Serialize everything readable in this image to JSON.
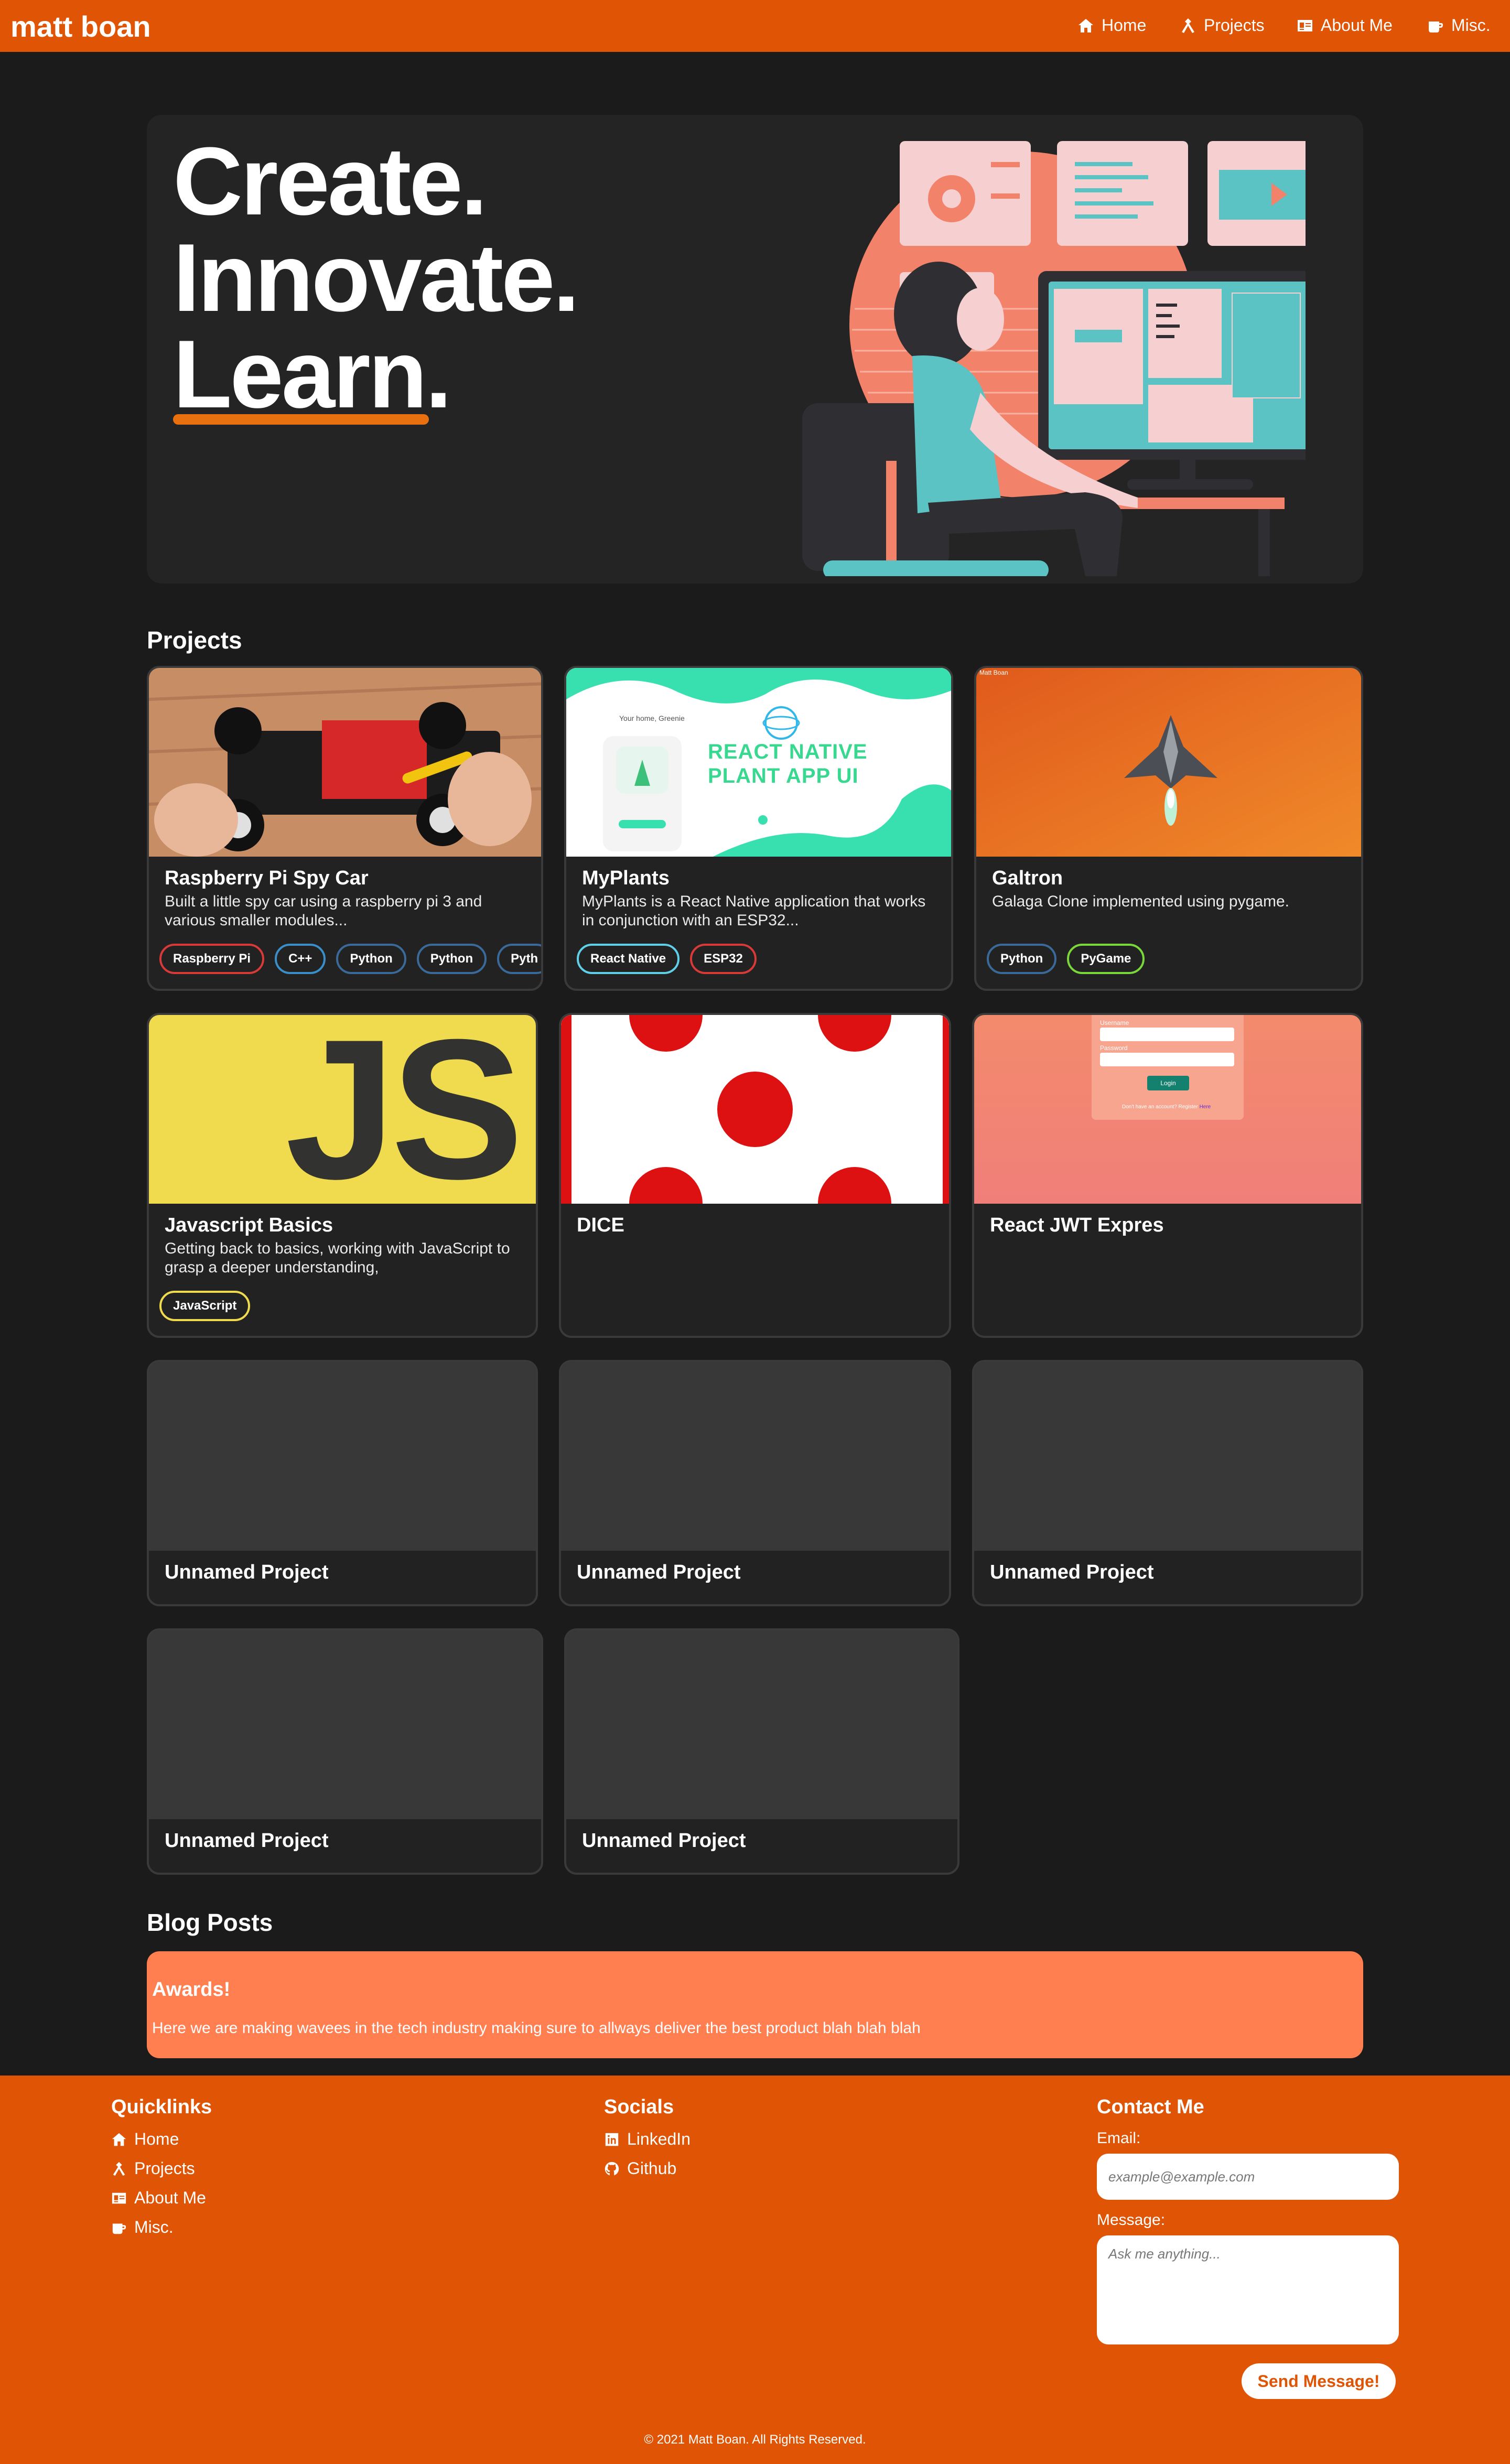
{
  "nav": {
    "brand": "matt boan",
    "items": [
      {
        "label": "Home",
        "icon": "home-icon"
      },
      {
        "label": "Projects",
        "icon": "tools-icon"
      },
      {
        "label": "About Me",
        "icon": "id-card-icon"
      },
      {
        "label": "Misc.",
        "icon": "mug-icon"
      }
    ]
  },
  "hero": {
    "lines": [
      "Create.",
      "Innovate.",
      "Learn."
    ],
    "accent_color": "#e9700f"
  },
  "projects": {
    "title": "Projects",
    "cards": [
      {
        "title": "Raspberry Pi Spy Car",
        "desc": "Built a little spy car using a raspberry pi 3 and various smaller modules...",
        "tags": [
          "Raspberry Pi",
          "C++",
          "Python",
          "Python",
          "Pyth"
        ]
      },
      {
        "title": "MyPlants",
        "desc": "MyPlants is a React Native application that works in conjunction with an ESP32...",
        "tags": [
          "React Native",
          "ESP32"
        ],
        "thumb": {
          "title_line1": "REACT NATIVE",
          "title_line2": "PLANT APP UI",
          "greeting": "Your home, Greenie"
        }
      },
      {
        "title": "Galtron",
        "desc": "Galaga Clone implemented using pygame.",
        "tags": [
          "Python",
          "PyGame"
        ],
        "thumb": {
          "caption": "Matt Boan"
        }
      },
      {
        "title": "Javascript Basics",
        "desc": "Getting back to basics, working with JavaScript to grasp a deeper understanding,",
        "tags": [
          "JavaScript"
        ],
        "thumb": {
          "logo": "JS"
        }
      },
      {
        "title": "DICE",
        "desc": "",
        "tags": []
      },
      {
        "title": "React JWT Expres",
        "desc": "",
        "tags": [],
        "thumb": {
          "username": "Username",
          "password": "Password",
          "login": "Login",
          "register": "Don't have an account? Register",
          "register_link": "Here"
        }
      },
      {
        "title": "Unnamed Project"
      },
      {
        "title": "Unnamed Project"
      },
      {
        "title": "Unnamed Project"
      },
      {
        "title": "Unnamed Project"
      },
      {
        "title": "Unnamed Project"
      }
    ]
  },
  "blog": {
    "title": "Blog Posts",
    "posts": [
      {
        "title": "Awards!",
        "body": "Here we are making wavees in the tech industry making sure to allways deliver the best product blah blah blah"
      }
    ]
  },
  "footer": {
    "quicklinks": {
      "title": "Quicklinks",
      "items": [
        {
          "label": "Home",
          "icon": "home-icon"
        },
        {
          "label": "Projects",
          "icon": "tools-icon"
        },
        {
          "label": "About Me",
          "icon": "id-card-icon"
        },
        {
          "label": "Misc.",
          "icon": "mug-icon"
        }
      ]
    },
    "socials": {
      "title": "Socials",
      "items": [
        {
          "label": "LinkedIn",
          "icon": "linkedin-icon"
        },
        {
          "label": "Github",
          "icon": "github-icon"
        }
      ]
    },
    "contact": {
      "title": "Contact Me",
      "email_label": "Email:",
      "email_placeholder": "example@example.com",
      "message_label": "Message:",
      "message_placeholder": "Ask me anything...",
      "send_label": "Send Message!"
    },
    "copyright": "© 2021 Matt Boan. All Rights Reserved."
  },
  "colors": {
    "brand": "#df5505",
    "background": "#1b1b1b",
    "card": "#222222",
    "blog": "#ff7f50"
  }
}
